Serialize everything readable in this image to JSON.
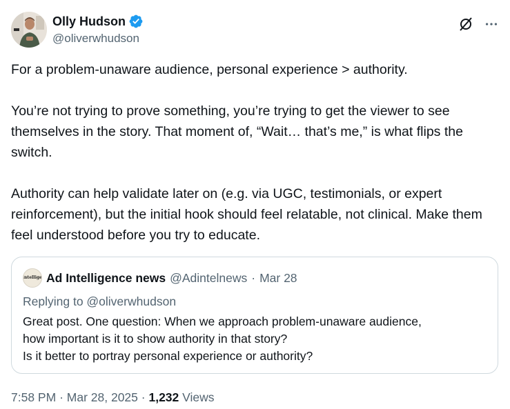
{
  "author": {
    "display_name": "Olly Hudson",
    "handle": "@oliverwhudson",
    "verified_color": "#1d9bf0",
    "avatar_icon": "user-avatar-photo"
  },
  "header_actions": {
    "grok_icon": "grok-icon",
    "more_icon": "more-horizontal-icon"
  },
  "tweet": {
    "paragraphs": [
      "For a problem-unaware audience, personal experience > authority.",
      "You’re not trying to prove something, you’re trying to get the viewer to see themselves in the story. That moment of, “Wait… that’s me,” is what flips the switch.",
      "Authority can help validate later on (e.g. via UGC, testimonials, or expert reinforcement), but the initial hook should feel relatable, not clinical. Make them feel understood before you try to educate."
    ]
  },
  "quoted": {
    "avatar_text": "Ad Intelligence",
    "display_name": "Ad Intelligence news",
    "handle": "@Adintelnews",
    "separator": "·",
    "date": "Mar 28",
    "replying_to": "Replying to @oliverwhudson",
    "lines": [
      "Great post. One question: When we approach problem-unaware audience,",
      "how important is it to show authority in that story?",
      "Is it better to portray personal experience or authority?"
    ]
  },
  "meta": {
    "time": "7:58 PM",
    "separator": "·",
    "date": "Mar 28, 2025",
    "views_count": "1,232",
    "views_label": "Views"
  },
  "colors": {
    "text_primary": "#0f1419",
    "text_secondary": "#536471",
    "border": "#cfd9de"
  }
}
